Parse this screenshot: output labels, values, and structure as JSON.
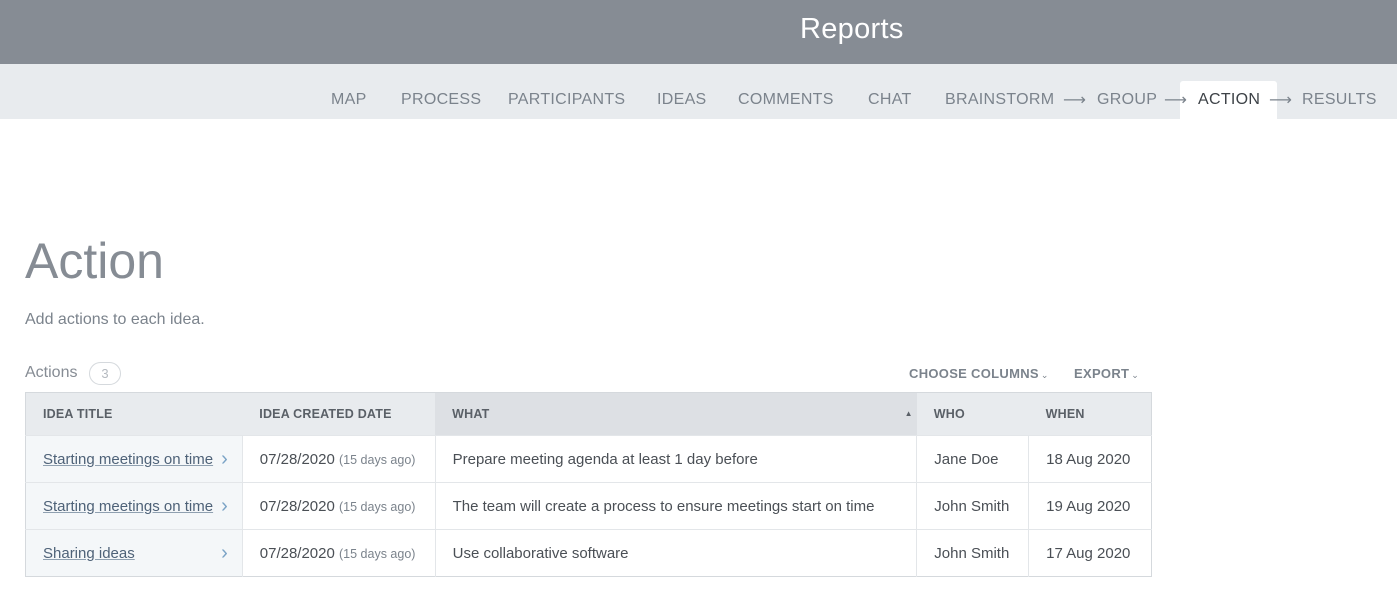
{
  "header": {
    "title": "Reports"
  },
  "nav": {
    "items": [
      {
        "label": "MAP"
      },
      {
        "label": "PROCESS"
      },
      {
        "label": "PARTICIPANTS"
      },
      {
        "label": "IDEAS"
      },
      {
        "label": "COMMENTS"
      },
      {
        "label": "CHAT"
      },
      {
        "label": "BRAINSTORM"
      },
      {
        "label": "GROUP"
      },
      {
        "label": "ACTION"
      },
      {
        "label": "RESULTS"
      }
    ],
    "active": "ACTION",
    "arrow": "⟶"
  },
  "page": {
    "title": "Action",
    "subtitle": "Add actions to each idea."
  },
  "toolbar": {
    "actions_label": "Actions",
    "count": "3",
    "choose_columns": "CHOOSE COLUMNS",
    "export": "EXPORT",
    "chevron": "⌄"
  },
  "table": {
    "headers": [
      "IDEA TITLE",
      "IDEA CREATED DATE",
      "WHAT",
      "WHO",
      "WHEN"
    ],
    "sort_indicator": "▲",
    "rows": [
      {
        "idea_title": "Starting meetings on time",
        "date": "07/28/2020",
        "ago": "(15 days ago)",
        "what": "Prepare meeting agenda at least 1 day before",
        "who": "Jane Doe",
        "when": "18 Aug 2020"
      },
      {
        "idea_title": "Starting meetings on time",
        "date": "07/28/2020",
        "ago": "(15 days ago)",
        "what": "The team will create a process to ensure meetings start on time",
        "who": "John Smith",
        "when": "19 Aug 2020"
      },
      {
        "idea_title": "Sharing ideas",
        "date": "07/28/2020",
        "ago": "(15 days ago)",
        "what": "Use collaborative software",
        "who": "John Smith",
        "when": "17 Aug 2020"
      }
    ],
    "row_chevron": "›"
  }
}
